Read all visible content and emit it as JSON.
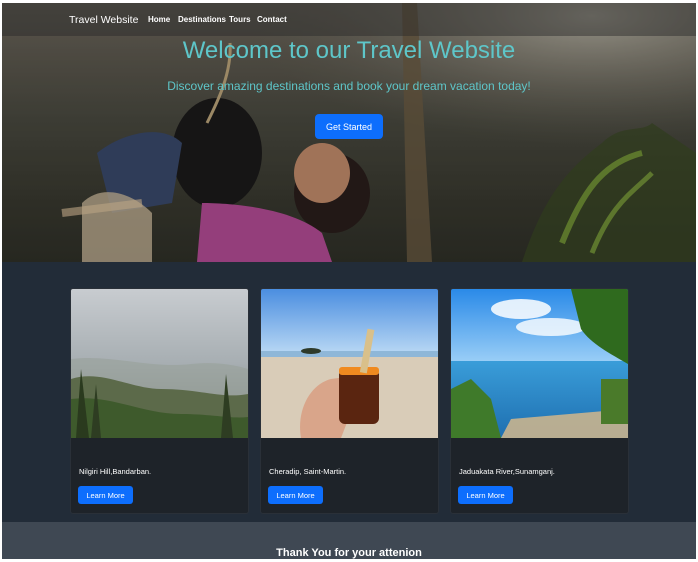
{
  "nav": {
    "brand": "Travel Website",
    "links": [
      "Home",
      "Destinations",
      "Tours",
      "Contact"
    ]
  },
  "hero": {
    "title": "Welcome to our Travel Website",
    "subtitle": "Discover amazing destinations and book your dream vacation today!",
    "cta": "Get Started",
    "accent": "#5ec6c9"
  },
  "cards": [
    {
      "title": "Nilgiri Hill,Bandarban.",
      "button": "Learn More"
    },
    {
      "title": "Cheradip, Saint-Martin.",
      "button": "Learn More"
    },
    {
      "title": "Jaduakata River,Sunamganj.",
      "button": "Learn More"
    }
  ],
  "footer": {
    "text": "Thank You for your attenion"
  },
  "colors": {
    "primary": "#0d6efd",
    "page_bg": "#222c38",
    "card_bg": "#1e2329",
    "footer_bg": "#3f4853"
  }
}
